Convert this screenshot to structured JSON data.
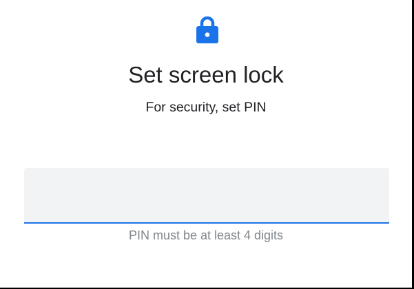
{
  "screen": {
    "title": "Set screen lock",
    "subtitle": "For security, set PIN",
    "lock_icon": "lock-icon",
    "pin_field": {
      "value": "",
      "placeholder": ""
    },
    "helper_text": "PIN must be at least 4 digits"
  },
  "colors": {
    "accent": "#1a73e8",
    "field_background": "#f1f3f4",
    "text_primary": "#202124",
    "text_secondary": "#80868b"
  }
}
